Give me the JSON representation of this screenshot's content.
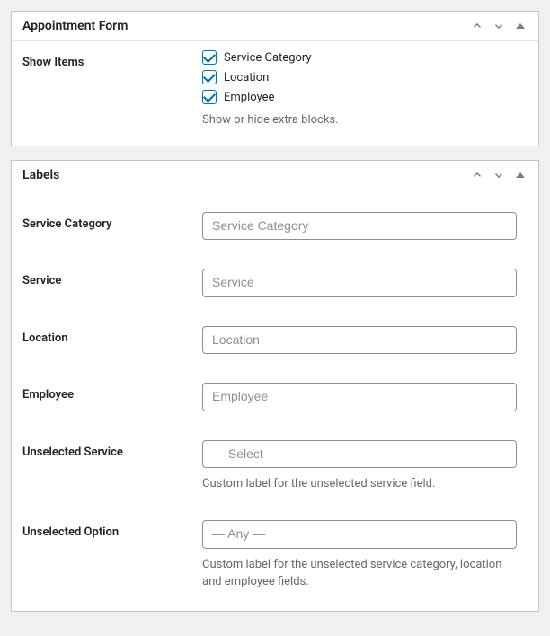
{
  "panels": {
    "appointment_form": {
      "title": "Appointment Form",
      "show_items": {
        "label": "Show Items",
        "options": {
          "service_category": "Service Category",
          "location": "Location",
          "employee": "Employee"
        },
        "help": "Show or hide extra blocks."
      }
    },
    "labels": {
      "title": "Labels",
      "fields": {
        "service_category": {
          "label": "Service Category",
          "placeholder": "Service Category"
        },
        "service": {
          "label": "Service",
          "placeholder": "Service"
        },
        "location": {
          "label": "Location",
          "placeholder": "Location"
        },
        "employee": {
          "label": "Employee",
          "placeholder": "Employee"
        },
        "unselected_service": {
          "label": "Unselected Service",
          "placeholder": "— Select —",
          "help": "Custom label for the unselected service field."
        },
        "unselected_option": {
          "label": "Unselected Option",
          "placeholder": "— Any —",
          "help": "Custom label for the unselected service category, location and employee fields."
        }
      }
    }
  }
}
